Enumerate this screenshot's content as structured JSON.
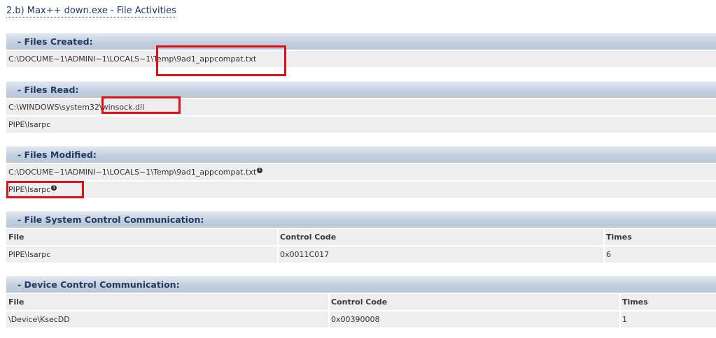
{
  "page_title": "2.b) Max++ down.exe - File Activities",
  "files_created": {
    "title": "- Files Created:",
    "rows": [
      "C:\\DOCUME~1\\ADMINI~1\\LOCALS~1\\Temp\\9ad1_appcompat.txt"
    ]
  },
  "files_read": {
    "title": "- Files Read:",
    "rows": [
      "C:\\WINDOWS\\system32\\winsock.dll",
      "PIPE\\lsarpc"
    ]
  },
  "files_modified": {
    "title": "- Files Modified:",
    "rows": [
      "C:\\DOCUME~1\\ADMINI~1\\LOCALS~1\\Temp\\9ad1_appcompat.txt",
      "PIPE\\lsarpc"
    ],
    "info_glyph": "i"
  },
  "fs_control": {
    "title": "- File System Control Communication:",
    "headers": {
      "file": "File",
      "code": "Control Code",
      "times": "Times"
    },
    "rows": [
      {
        "file": "PIPE\\lsarpc",
        "code": "0x0011C017",
        "times": "6"
      }
    ]
  },
  "device_control": {
    "title": "- Device Control Communication:",
    "headers": {
      "file": "File",
      "code": "Control Code",
      "times": "Times"
    },
    "rows": [
      {
        "file": "\\Device\\KsecDD",
        "code": "0x00390008",
        "times": "1"
      }
    ]
  },
  "colors": {
    "header_gradient_top": "#e1e8f1",
    "header_gradient_bottom": "#b9c7d8",
    "header_text": "#243c64",
    "row_bg": "#eeeeee",
    "highlight_box": "#e0101a"
  }
}
